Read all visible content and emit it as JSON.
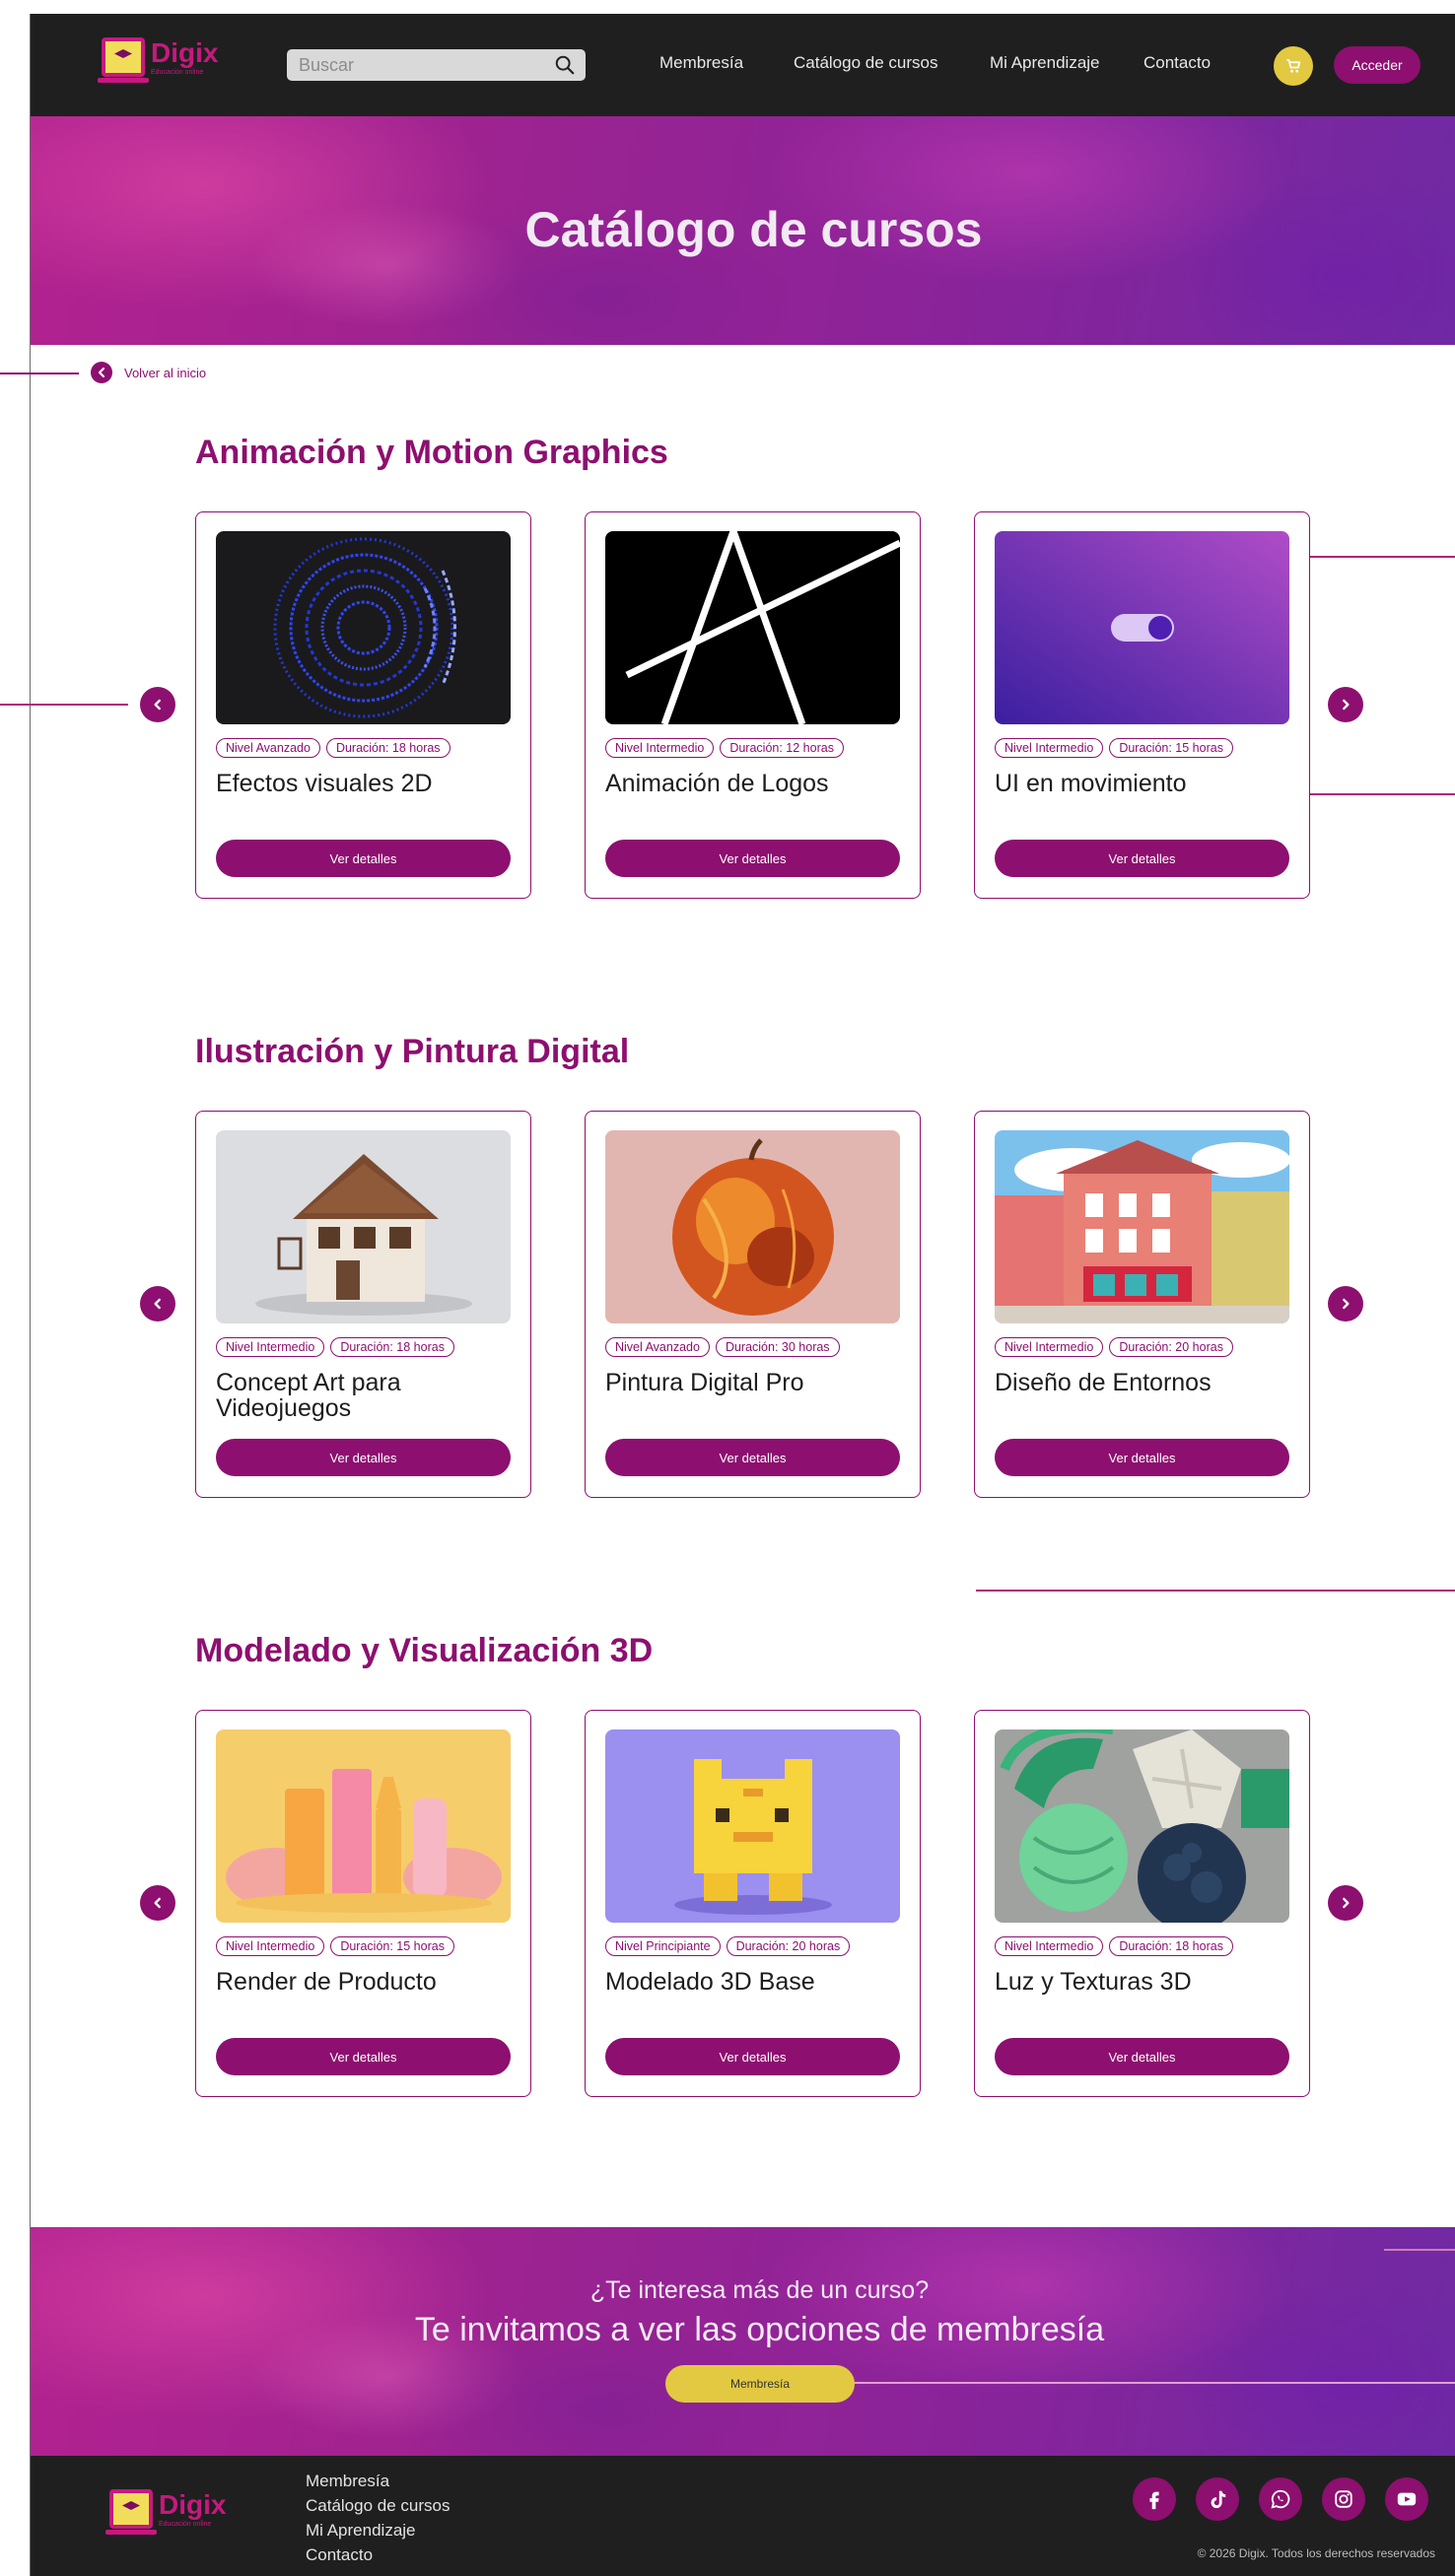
{
  "header": {
    "brand_name": "Digix",
    "brand_tagline": "Educación online",
    "search_placeholder": "Buscar",
    "nav": [
      "Membresía",
      "Catálogo de cursos",
      "Mi Aprendizaje",
      "Contacto"
    ],
    "login_label": "Acceder"
  },
  "hero": {
    "title": "Catálogo de cursos"
  },
  "back_link": {
    "label": "Volver al inicio"
  },
  "sections": [
    {
      "title": "Animación y Motion Graphics",
      "courses": [
        {
          "title": "Efectos visuales 2D",
          "level": "Nivel Avanzado",
          "duration": "Duración: 18 horas",
          "button": "Ver detalles"
        },
        {
          "title": "Animación de Logos",
          "level": "Nivel Intermedio",
          "duration": "Duración: 12 horas",
          "button": "Ver detalles"
        },
        {
          "title": "UI en movimiento",
          "level": "Nivel Intermedio",
          "duration": "Duración: 15 horas",
          "button": "Ver detalles"
        }
      ]
    },
    {
      "title": "Ilustración y Pintura Digital",
      "courses": [
        {
          "title": "Concept Art para Videojuegos",
          "level": "Nivel Intermedio",
          "duration": "Duración: 18 horas",
          "button": "Ver detalles"
        },
        {
          "title": "Pintura Digital Pro",
          "level": "Nivel Avanzado",
          "duration": "Duración: 30 horas",
          "button": "Ver detalles"
        },
        {
          "title": "Diseño de Entornos",
          "level": "Nivel Intermedio",
          "duration": "Duración: 20 horas",
          "button": "Ver detalles"
        }
      ]
    },
    {
      "title": "Modelado y Visualización 3D",
      "courses": [
        {
          "title": "Render de Producto",
          "level": "Nivel Intermedio",
          "duration": "Duración: 15 horas",
          "button": "Ver detalles"
        },
        {
          "title": "Modelado 3D Base",
          "level": "Nivel Principiante",
          "duration": "Duración: 20 horas",
          "button": "Ver detalles"
        },
        {
          "title": "Luz y Texturas 3D",
          "level": "Nivel Intermedio",
          "duration": "Duración: 18 horas",
          "button": "Ver detalles"
        }
      ]
    }
  ],
  "cta": {
    "question": "¿Te interesa más de un curso?",
    "headline": "Te invitamos a ver las opciones de membresía",
    "button": "Membresía"
  },
  "footer": {
    "links": [
      "Membresía",
      "Catálogo de cursos",
      "Mi Aprendizaje",
      "Contacto"
    ],
    "socials": [
      "facebook-icon",
      "tiktok-icon",
      "whatsapp-icon",
      "instagram-icon",
      "youtube-icon"
    ],
    "copyright": "© 2026 Digix. Todos los derechos reservados"
  },
  "colors": {
    "accent": "#8d0f6f",
    "yellow": "#e2c941",
    "dark": "#1f1f1f"
  }
}
